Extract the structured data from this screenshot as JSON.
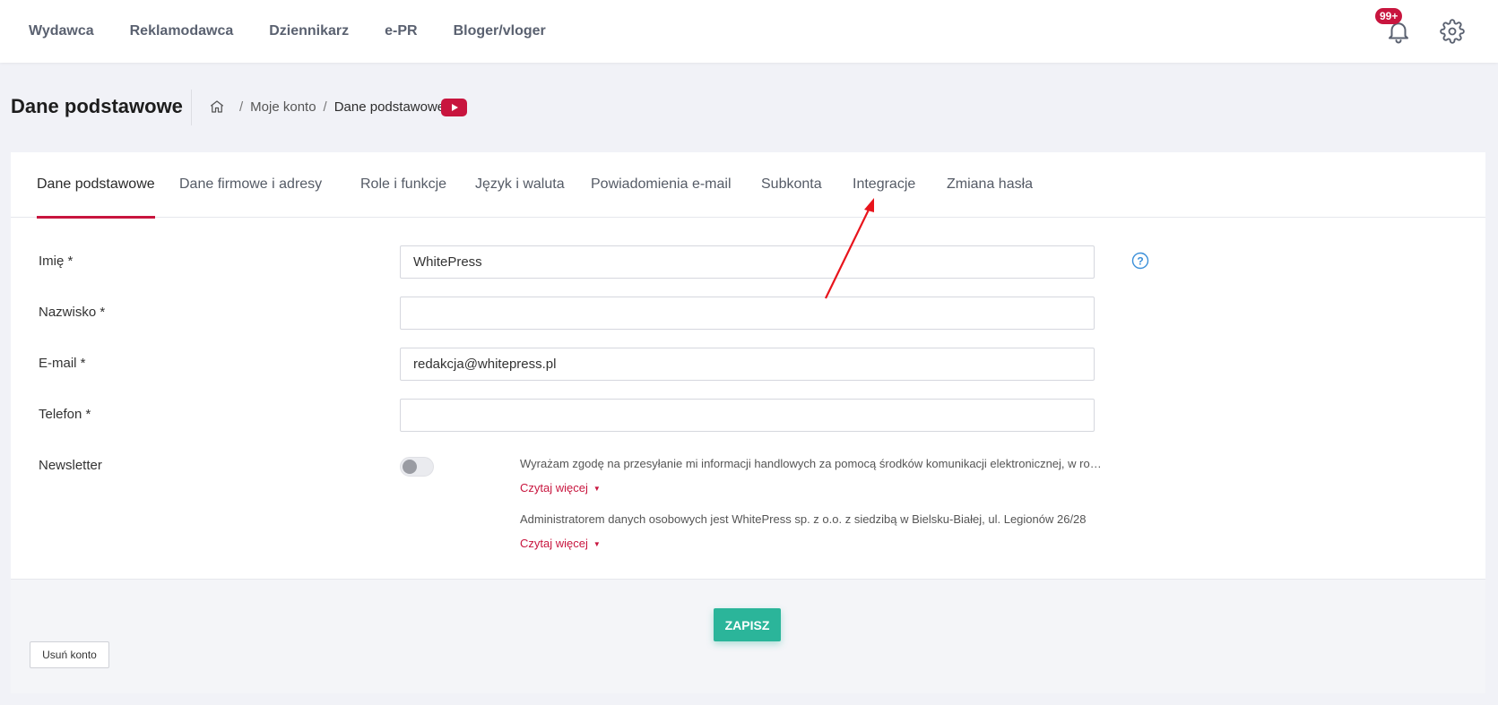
{
  "topnav": {
    "items": [
      {
        "label": "Wydawca"
      },
      {
        "label": "Reklamodawca"
      },
      {
        "label": "Dziennikarz"
      },
      {
        "label": "e-PR"
      },
      {
        "label": "Bloger/vloger"
      }
    ],
    "notifications_badge": "99+"
  },
  "page": {
    "title": "Dane podstawowe",
    "breadcrumb": {
      "items": [
        "Moje konto",
        "Dane podstawowe"
      ],
      "separator": "/"
    }
  },
  "tabs": [
    {
      "label": "Dane podstawowe",
      "active": true
    },
    {
      "label": "Dane firmowe i adresy"
    },
    {
      "label": "Role i funkcje"
    },
    {
      "label": "Język i waluta"
    },
    {
      "label": "Powiadomienia e-mail"
    },
    {
      "label": "Subkonta"
    },
    {
      "label": "Integracje"
    },
    {
      "label": "Zmiana hasła"
    }
  ],
  "form": {
    "first_name": {
      "label": "Imię *",
      "value": "WhitePress"
    },
    "last_name": {
      "label": "Nazwisko *",
      "value": ""
    },
    "email": {
      "label": "E-mail *",
      "value": "redakcja@whitepress.pl"
    },
    "phone": {
      "label": "Telefon *",
      "value": ""
    },
    "newsletter": {
      "label": "Newsletter",
      "enabled": false,
      "consent_1": "Wyrażam zgodę na przesyłanie mi informacji handlowych za pomocą środków komunikacji elektronicznej, w rozumieniu ustawy",
      "consent_2": "Administratorem danych osobowych jest WhitePress sp. z o.o. z siedzibą w Bielsku-Białej, ul. Legionów 26/28",
      "read_more": "Czytaj więcej"
    }
  },
  "actions": {
    "save": "ZAPISZ",
    "delete_account": "Usuń konto"
  },
  "colors": {
    "accent": "#c8153e",
    "save": "#2bb59a",
    "annotation_arrow": "#e8141c"
  }
}
